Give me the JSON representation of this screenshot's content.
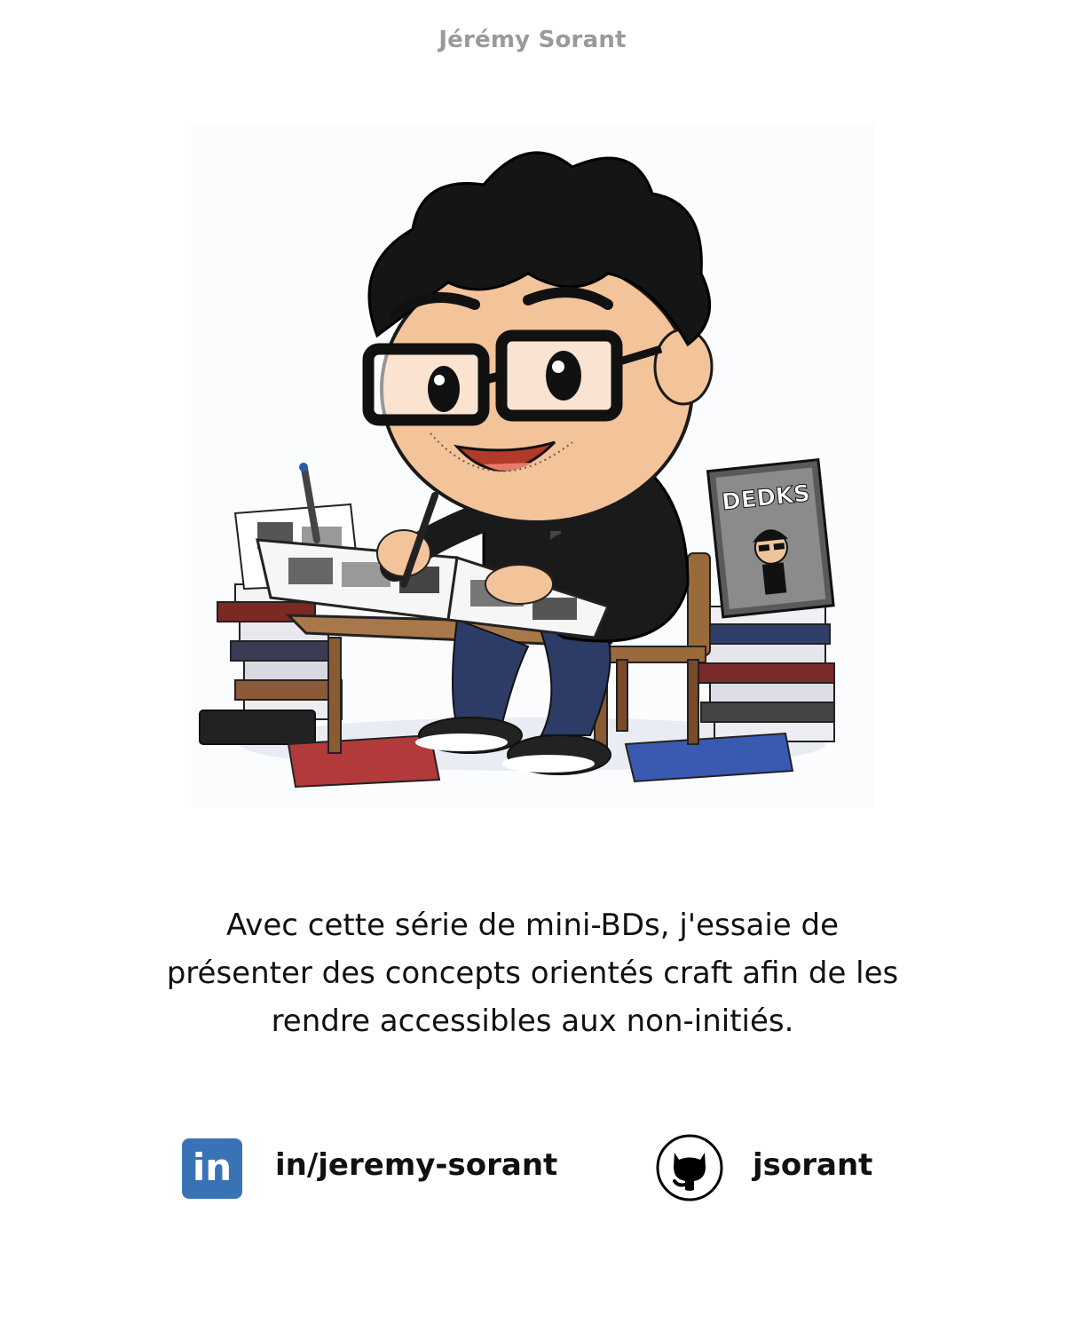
{
  "header": {
    "author": "Jérémy Sorant"
  },
  "illustration": {
    "comic_cover_title": "DEDKS"
  },
  "caption": {
    "line1": "Avec cette série de mini-BDs, j'essaie de",
    "line2": "présenter des concepts orientés craft afin de les",
    "line3": "rendre accessibles aux non-initiés."
  },
  "socials": {
    "linkedin": {
      "icon": "linkedin-icon",
      "icon_text": "in",
      "handle": "in/jeremy-sorant",
      "color": "#3a73b5"
    },
    "github": {
      "icon": "github-icon",
      "handle": "jsorant",
      "color": "#000000"
    }
  }
}
